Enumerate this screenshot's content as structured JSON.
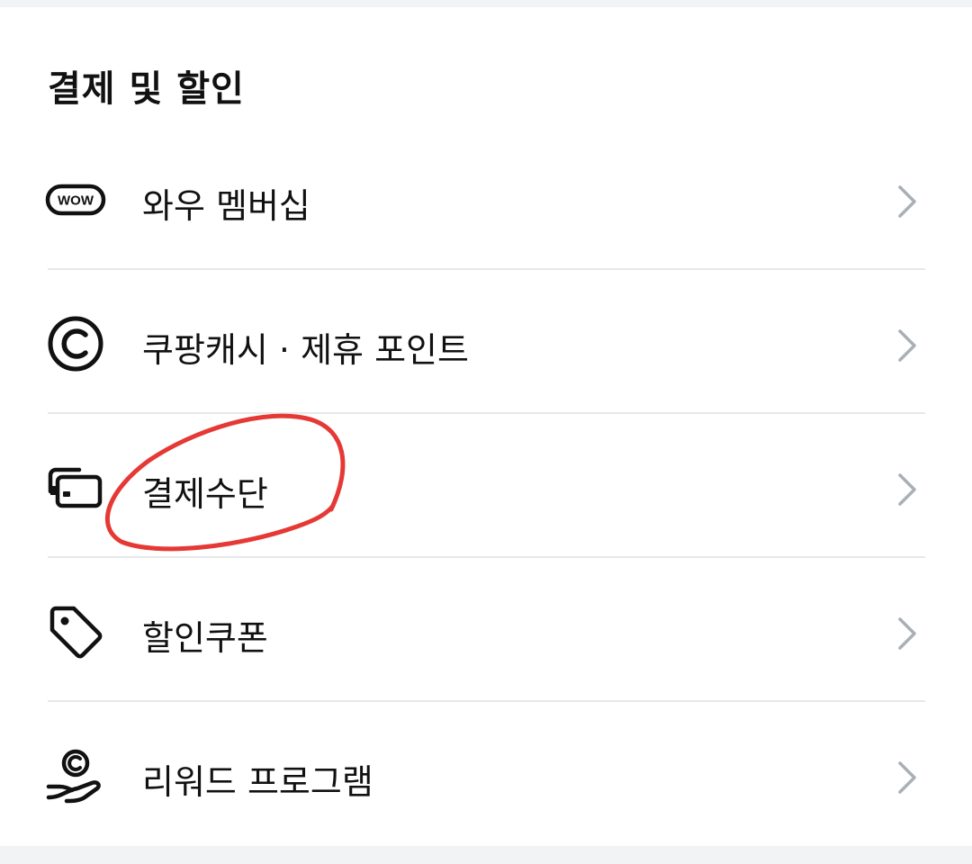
{
  "section": {
    "title": "결제 및 할인"
  },
  "menu": {
    "items": [
      {
        "label": "와우 멤버십",
        "icon": "wow-badge-icon"
      },
      {
        "label": "쿠팡캐시 · 제휴 포인트",
        "icon": "copyright-circle-icon"
      },
      {
        "label": "결제수단",
        "icon": "cards-icon"
      },
      {
        "label": "할인쿠폰",
        "icon": "tag-icon"
      },
      {
        "label": "리워드 프로그램",
        "icon": "coin-hand-icon"
      }
    ],
    "wow_badge_text": "WOW"
  },
  "colors": {
    "text": "#111111",
    "divider": "#e8e9eb",
    "chevron": "#a9afb6",
    "annotation": "#e53935"
  }
}
